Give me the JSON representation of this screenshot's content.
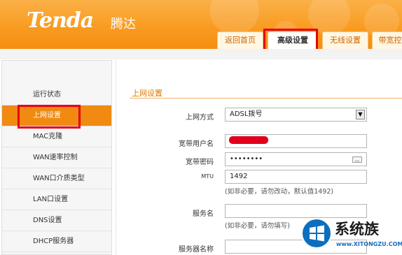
{
  "brand": {
    "logo": "Tenda",
    "name_cn": "腾达"
  },
  "tabs": [
    {
      "label": "返回首页",
      "active": false
    },
    {
      "label": "高级设置",
      "active": true
    },
    {
      "label": "无线设置",
      "active": false
    },
    {
      "label": "带宽控",
      "active": false
    }
  ],
  "sidebar": {
    "items": [
      {
        "label": "运行状态",
        "active": false
      },
      {
        "label": "上网设置",
        "active": true
      },
      {
        "label": "MAC克隆",
        "active": false
      },
      {
        "label": "WAN速率控制",
        "active": false
      },
      {
        "label": "WAN口介质类型",
        "active": false
      },
      {
        "label": "LAN口设置",
        "active": false
      },
      {
        "label": "DNS设置",
        "active": false
      },
      {
        "label": "DHCP服务器",
        "active": false
      }
    ]
  },
  "form": {
    "title": "上网设置",
    "mode_label": "上网方式",
    "mode_value": "ADSL拨号",
    "username_label": "宽带用户名",
    "password_label": "宽带密码",
    "password_value": "••••••••",
    "mtu_label": "MTU",
    "mtu_value": "1492",
    "mtu_hint": "(如非必要，请勿改动，默认值1492)",
    "service_label": "服务名",
    "service_value": "",
    "service_hint": "(如非必要，请勿填写)",
    "server_label": "服务器名称",
    "server_value": ""
  },
  "colors": {
    "header_orange": "#f99a1f",
    "active_orange": "#f08a11",
    "highlight_red": "#e60012",
    "title_orange": "#e07a00"
  },
  "watermark": {
    "text": "系统族",
    "url": "www.XITONGZU.COM"
  }
}
